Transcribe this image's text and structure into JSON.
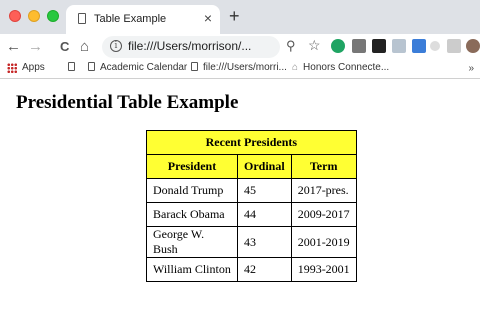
{
  "browser": {
    "tab_title": "Table Example",
    "tab_close": "×",
    "new_tab": "+",
    "url": "file:///Users/morrison/...",
    "nav": {
      "back": "←",
      "forward": "→",
      "reload": "C",
      "home": "⌂"
    },
    "bookmarks": {
      "apps": "Apps",
      "academic_calendar": "Academic Calendar",
      "file_link": "file:///Users/morri...",
      "honors": "Honors Connecte...",
      "more": "»"
    }
  },
  "page": {
    "heading": "Presidential Table Example",
    "table": {
      "caption": "Recent Presidents",
      "headers": [
        "President",
        "Ordinal",
        "Term"
      ],
      "rows": [
        [
          "Donald Trump",
          "45",
          "2017-pres."
        ],
        [
          "Barack Obama",
          "44",
          "2009-2017"
        ],
        [
          "George W. Bush",
          "43",
          "2001-2019"
        ],
        [
          "William Clinton",
          "42",
          "1993-2001"
        ]
      ]
    }
  },
  "colors": {
    "header_bg": "#ffff33",
    "tabstrip_bg": "#dee1e6"
  }
}
